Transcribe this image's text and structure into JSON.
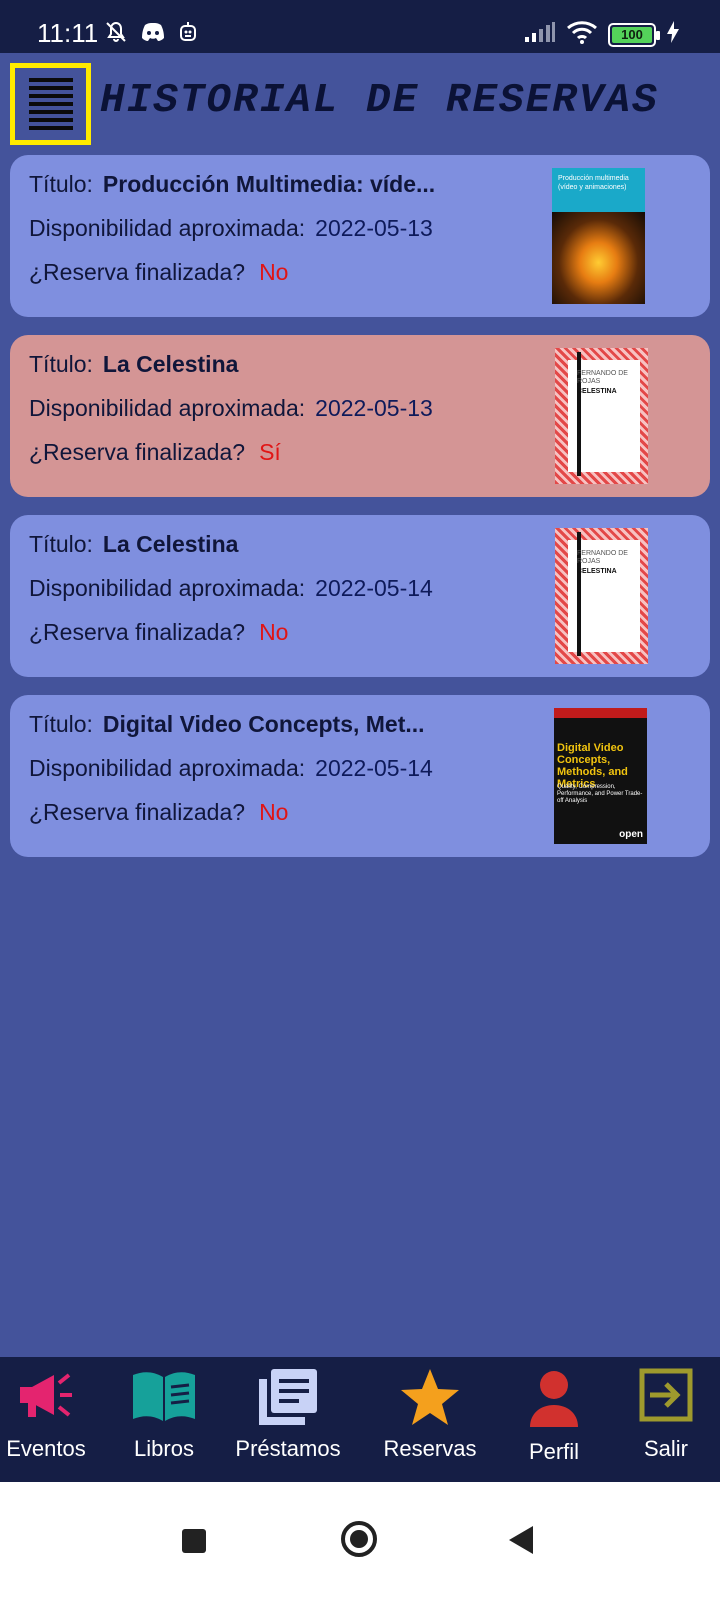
{
  "status_bar": {
    "time": "11:11",
    "battery": "100",
    "left_icons": [
      "muted-bell-icon",
      "discord-icon",
      "notification-icon"
    ],
    "right_icons": [
      "signal-icon",
      "wifi-icon",
      "battery-icon",
      "charging-icon"
    ]
  },
  "header": {
    "menu_icon": "hamburger-icon",
    "title": "HISTORIAL DE RESERVAS"
  },
  "labels": {
    "title": "Título:",
    "availability": "Disponibilidad aproximada:",
    "finished": "¿Reserva finalizada?"
  },
  "reservations": [
    {
      "title": "Producción Multimedia: víde...",
      "date": "2022-05-13",
      "finished": "No",
      "cover_band_text": "Producción multimedia (vídeo y animaciones)"
    },
    {
      "title": "La Celestina",
      "date": "2022-05-13",
      "finished": "Sí",
      "cover_author": "FERNANDO DE ROJAS",
      "cover_title": "CELESTINA"
    },
    {
      "title": "La Celestina",
      "date": "2022-05-14",
      "finished": "No",
      "cover_author": "FERNANDO DE ROJAS",
      "cover_title": "CELESTINA"
    },
    {
      "title": "Digital Video Concepts, Met...",
      "date": "2022-05-14",
      "finished": "No",
      "cover_title": "Digital Video Concepts, Methods, and Metrics",
      "cover_subtitle": "Quality, Compression, Performance, and Power Trade-off Analysis",
      "cover_badge": "open"
    }
  ],
  "colors": {
    "background": "#44539b",
    "card": "#7f8fdf",
    "card_finished": "#d49595",
    "status_red": "#e11515",
    "nav_bar": "#151e45",
    "menu_highlight": "#ffeb00"
  },
  "bottom_nav": {
    "eventos": {
      "label": "Eventos",
      "icon": "megaphone-icon",
      "color": "#e4246f"
    },
    "libros": {
      "label": "Libros",
      "icon": "open-book-icon",
      "color": "#16a19a"
    },
    "prestamos": {
      "label": "Préstamos",
      "icon": "library-books-icon",
      "color": "#c8d2f6"
    },
    "reservas": {
      "label": "Reservas",
      "icon": "star-icon",
      "color": "#f4a01d"
    },
    "perfil": {
      "label": "Perfil",
      "icon": "person-icon",
      "color": "#d1312e"
    },
    "salir": {
      "label": "Salir",
      "icon": "exit-icon",
      "color": "#9e9a2d"
    }
  },
  "system_nav": [
    "recents-button",
    "home-button",
    "back-button"
  ]
}
